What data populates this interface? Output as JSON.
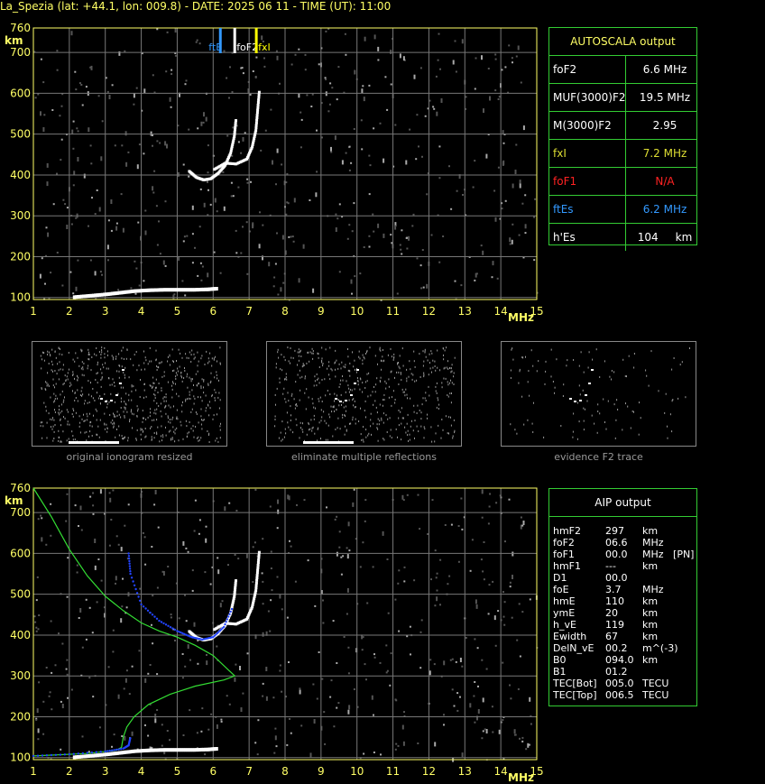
{
  "header": {
    "title": "La_Spezia (lat: +44.1, lon: 009.8) - DATE: 2025 06 11 - TIME (UT): 11:00"
  },
  "chart_data": [
    {
      "type": "scatter",
      "name_id": "ionogram-top",
      "xlabel": "MHz",
      "ylabel": "km",
      "xlim": [
        1,
        15
      ],
      "ylim": [
        95,
        760
      ],
      "xticks": [
        1,
        2,
        3,
        4,
        5,
        6,
        7,
        8,
        9,
        10,
        11,
        12,
        13,
        14,
        15
      ],
      "yticks": [
        100,
        200,
        300,
        400,
        500,
        600,
        700,
        760
      ],
      "grid": true,
      "markers": [
        {
          "label": "ftE",
          "x": 6.2,
          "color": "#3399ff"
        },
        {
          "label": "foF2",
          "x": 6.6,
          "color": "#ffffff"
        },
        {
          "label": "fxI",
          "x": 7.2,
          "color": "#ffff00"
        }
      ],
      "traces": [
        {
          "name": "E",
          "points": [
            [
              2.1,
              103
            ],
            [
              2.5,
              106
            ],
            [
              3.0,
              110
            ],
            [
              3.4,
              114
            ],
            [
              3.8,
              118
            ],
            [
              4.2,
              120
            ],
            [
              4.6,
              121
            ],
            [
              5.0,
              121
            ],
            [
              5.4,
              121
            ],
            [
              5.8,
              122
            ],
            [
              6.1,
              124
            ]
          ]
        },
        {
          "name": "F2-o",
          "points": [
            [
              5.3,
              410
            ],
            [
              5.5,
              395
            ],
            [
              5.7,
              389
            ],
            [
              5.9,
              392
            ],
            [
              6.1,
              405
            ],
            [
              6.3,
              425
            ],
            [
              6.45,
              455
            ],
            [
              6.55,
              495
            ],
            [
              6.6,
              540
            ]
          ]
        },
        {
          "name": "F2-x",
          "points": [
            [
              6.0,
              415
            ],
            [
              6.3,
              430
            ],
            [
              6.6,
              428
            ],
            [
              6.9,
              440
            ],
            [
              7.05,
              470
            ],
            [
              7.15,
              510
            ],
            [
              7.2,
              560
            ],
            [
              7.25,
              610
            ]
          ]
        }
      ]
    },
    {
      "type": "scatter",
      "name_id": "ionogram-bottom",
      "xlabel": "MHz",
      "ylabel": "km",
      "xlim": [
        1,
        15
      ],
      "ylim": [
        95,
        760
      ],
      "xticks": [
        1,
        2,
        3,
        4,
        5,
        6,
        7,
        8,
        9,
        10,
        11,
        12,
        13,
        14,
        15
      ],
      "yticks": [
        100,
        200,
        300,
        400,
        500,
        600,
        700,
        760
      ],
      "grid": true,
      "traces": [
        {
          "name": "E",
          "points": [
            [
              2.1,
              103
            ],
            [
              2.5,
              106
            ],
            [
              3.0,
              110
            ],
            [
              3.4,
              114
            ],
            [
              3.8,
              118
            ],
            [
              4.2,
              120
            ],
            [
              4.6,
              121
            ],
            [
              5.0,
              121
            ],
            [
              5.4,
              121
            ],
            [
              5.8,
              122
            ],
            [
              6.1,
              124
            ]
          ]
        },
        {
          "name": "F2-o",
          "points": [
            [
              5.3,
              410
            ],
            [
              5.5,
              395
            ],
            [
              5.7,
              389
            ],
            [
              5.9,
              392
            ],
            [
              6.1,
              405
            ],
            [
              6.3,
              425
            ],
            [
              6.45,
              455
            ],
            [
              6.55,
              495
            ],
            [
              6.6,
              540
            ]
          ]
        },
        {
          "name": "F2-x",
          "points": [
            [
              6.0,
              415
            ],
            [
              6.3,
              430
            ],
            [
              6.6,
              428
            ],
            [
              6.9,
              440
            ],
            [
              7.05,
              470
            ],
            [
              7.15,
              510
            ],
            [
              7.2,
              560
            ],
            [
              7.25,
              610
            ]
          ]
        }
      ],
      "profile": {
        "color": "#33dd33",
        "points": [
          [
            1.0,
            760
          ],
          [
            1.5,
            690
          ],
          [
            2.0,
            610
          ],
          [
            2.5,
            545
          ],
          [
            3.0,
            495
          ],
          [
            3.5,
            460
          ],
          [
            4.0,
            430
          ],
          [
            4.5,
            410
          ],
          [
            5.0,
            395
          ],
          [
            5.5,
            375
          ],
          [
            6.0,
            350
          ],
          [
            6.6,
            300
          ],
          [
            6.3,
            290
          ],
          [
            5.5,
            275
          ],
          [
            4.8,
            255
          ],
          [
            4.2,
            230
          ],
          [
            3.8,
            200
          ],
          [
            3.6,
            175
          ],
          [
            3.5,
            150
          ],
          [
            3.45,
            125
          ],
          [
            3.3,
            118
          ],
          [
            2.5,
            110
          ],
          [
            1.5,
            106
          ],
          [
            1.0,
            104
          ]
        ]
      },
      "fitted": {
        "color": "#2244ff",
        "points": [
          [
            1.0,
            104
          ],
          [
            2.0,
            108
          ],
          [
            3.0,
            115
          ],
          [
            3.5,
            122
          ],
          [
            3.65,
            130
          ],
          [
            3.7,
            150
          ],
          [
            3.65,
            600
          ],
          [
            3.7,
            550
          ],
          [
            4.0,
            475
          ],
          [
            4.5,
            435
          ],
          [
            5.0,
            410
          ],
          [
            5.4,
            395
          ],
          [
            5.7,
            389
          ],
          [
            6.0,
            395
          ],
          [
            6.3,
            420
          ],
          [
            6.55,
            470
          ]
        ]
      }
    }
  ],
  "autoscala": {
    "title": "AUTOSCALA output",
    "rows": [
      {
        "k": "foF2",
        "v": "6.6 MHz",
        "color": "#ffffff"
      },
      {
        "k": "MUF(3000)F2",
        "v": "19.5 MHz",
        "color": "#ffffff"
      },
      {
        "k": "M(3000)F2",
        "v": "2.95",
        "color": "#ffffff"
      },
      {
        "k": "fxI",
        "v": "7.2 MHz",
        "color": "#dddd33"
      },
      {
        "k": "foF1",
        "v": "N/A",
        "color": "#ff2222"
      },
      {
        "k": "ftEs",
        "v": "6.2 MHz",
        "color": "#3399ff"
      },
      {
        "k": "h'Es",
        "v": "104     km",
        "color": "#ffffff"
      }
    ]
  },
  "aip": {
    "title": "AIP output",
    "rows": [
      {
        "k": "hmF2",
        "v": "297",
        "u": "km"
      },
      {
        "k": "foF2",
        "v": "06.6",
        "u": "MHz"
      },
      {
        "k": "foF1",
        "v": "00.0",
        "u": "MHz   [PN]"
      },
      {
        "k": "hmF1",
        "v": "---",
        "u": "km"
      },
      {
        "k": "D1",
        "v": "00.0",
        "u": ""
      },
      {
        "k": "foE",
        "v": "3.7",
        "u": "MHz"
      },
      {
        "k": "hmE",
        "v": "110",
        "u": "km"
      },
      {
        "k": "ymE",
        "v": "20",
        "u": "km"
      },
      {
        "k": "h_vE",
        "v": "119",
        "u": "km"
      },
      {
        "k": "Ewidth",
        "v": "67",
        "u": "km"
      },
      {
        "k": "DelN_vE",
        "v": "00.2",
        "u": "m^(-3)"
      },
      {
        "k": "B0",
        "v": "094.0",
        "u": "km"
      },
      {
        "k": "B1",
        "v": "01.2",
        "u": ""
      },
      {
        "k": "TEC[Bot]",
        "v": "005.0",
        "u": "TECU"
      },
      {
        "k": "TEC[Top]",
        "v": "006.5",
        "u": "TECU"
      }
    ]
  },
  "thumbnails": [
    {
      "caption": "original ionogram resized"
    },
    {
      "caption": "eliminate multiple reflections"
    },
    {
      "caption": "evidence F2 trace"
    }
  ]
}
